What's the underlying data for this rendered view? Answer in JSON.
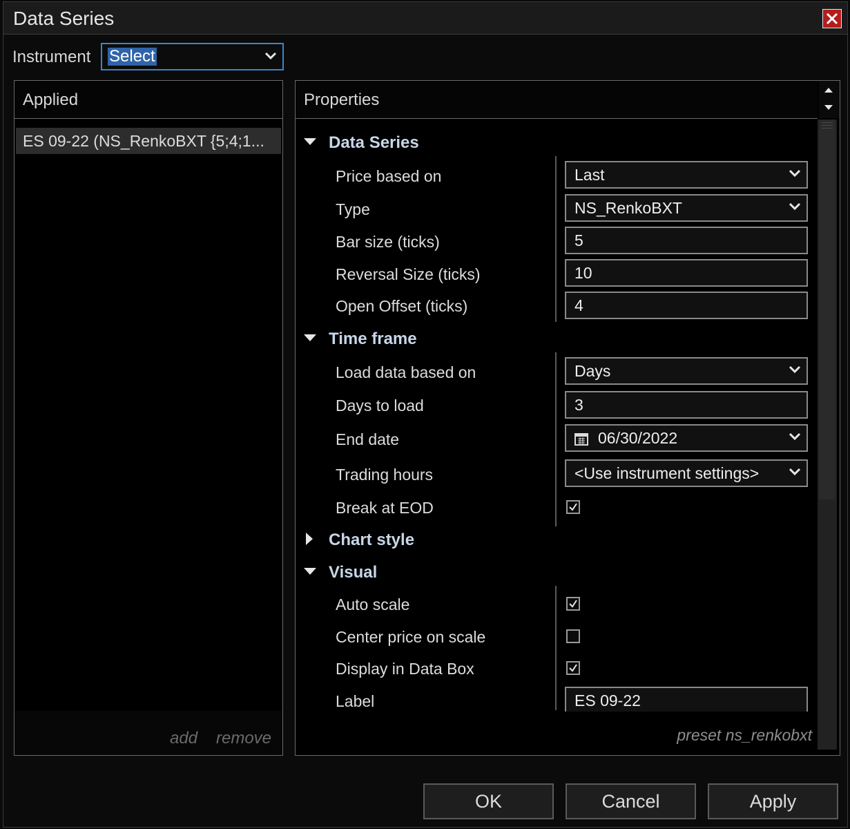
{
  "window": {
    "title": "Data Series"
  },
  "instrument": {
    "label": "Instrument",
    "selected": "Select"
  },
  "applied": {
    "header": "Applied",
    "items": [
      {
        "label": "ES 09-22 (NS_RenkoBXT {5;4;1..."
      }
    ],
    "add_label": "add",
    "remove_label": "remove"
  },
  "properties": {
    "header": "Properties",
    "sections": {
      "data_series": "Data Series",
      "time_frame": "Time frame",
      "chart_style": "Chart style",
      "visual": "Visual"
    },
    "rows": {
      "price_based_on": {
        "label": "Price based on",
        "value": "Last"
      },
      "type": {
        "label": "Type",
        "value": "NS_RenkoBXT"
      },
      "bar_size": {
        "label": "Bar size (ticks)",
        "value": "5"
      },
      "reversal_size": {
        "label": "Reversal Size (ticks)",
        "value": "10"
      },
      "open_offset": {
        "label": "Open Offset (ticks)",
        "value": "4"
      },
      "load_data_based_on": {
        "label": "Load data based on",
        "value": "Days"
      },
      "days_to_load": {
        "label": "Days to load",
        "value": "3"
      },
      "end_date": {
        "label": "End date",
        "value": "06/30/2022"
      },
      "trading_hours": {
        "label": "Trading hours",
        "value": "<Use instrument settings>"
      },
      "break_at_eod": {
        "label": "Break at EOD",
        "checked": true
      },
      "auto_scale": {
        "label": "Auto scale",
        "checked": true
      },
      "center_price": {
        "label": "Center price on scale",
        "checked": false
      },
      "display_in_data_box": {
        "label": "Display in Data Box",
        "checked": true
      },
      "label": {
        "label": "Label",
        "value": "ES 09-22"
      }
    },
    "preset": "preset ns_renkobxt"
  },
  "buttons": {
    "ok": "OK",
    "cancel": "Cancel",
    "apply": "Apply"
  },
  "colors": {
    "close": "#b51d1d",
    "focus": "#3d86c6",
    "selection": "#2f64a8"
  }
}
